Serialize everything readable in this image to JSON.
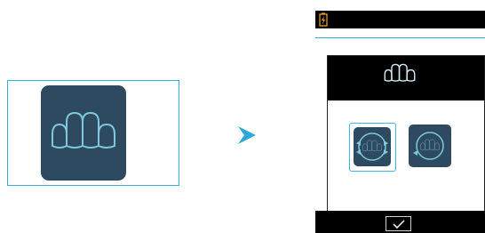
{
  "screen": {
    "source_tile": {
      "icon": "teeth-arch-icon"
    },
    "transition": {
      "icon": "arrow-right-icon"
    },
    "device": {
      "status_bar": {
        "icon": "battery-charging-icon"
      },
      "header": {
        "icon": "teeth-arch-icon"
      },
      "options": [
        {
          "icon": "teeth-rotate-both-icon",
          "selected": true
        },
        {
          "icon": "teeth-rotate-single-icon",
          "selected": false
        }
      ],
      "footer": {
        "confirm_icon": "check-icon"
      }
    }
  },
  "colors": {
    "tile": "#2e4a60",
    "accent": "#2eb4dd",
    "bar": "#000000",
    "battery": "#f5a623"
  }
}
